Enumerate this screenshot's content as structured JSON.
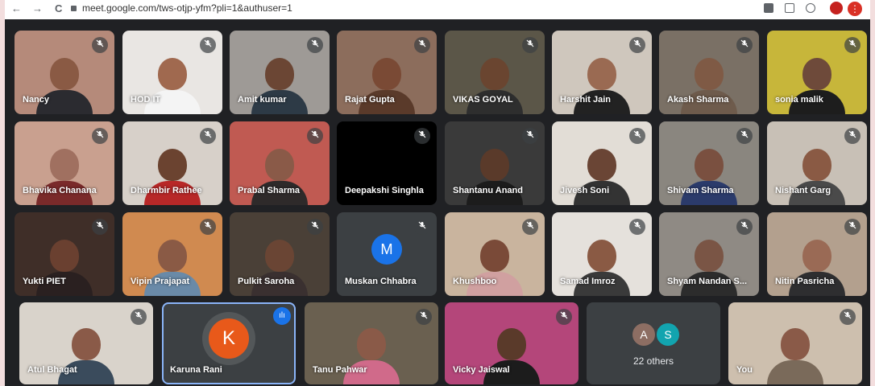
{
  "browser": {
    "url": "meet.google.com/tws-otjp-yfm?pli=1&authuser=1",
    "back": "←",
    "forward": "→",
    "reload": "C",
    "menu": "⋮"
  },
  "mute_glyph": "🎙",
  "participants": [
    {
      "name": "Nancy",
      "skin": "#8a5a44",
      "bg": "#b58a7a",
      "shirt": "#2b2b30"
    },
    {
      "name": "HOD IT",
      "skin": "#a0694f",
      "bg": "#e9e6e3",
      "shirt": "#f4f4f4"
    },
    {
      "name": "Amit kumar",
      "skin": "#6b4634",
      "bg": "#9e9a96",
      "shirt": "#2d3a46"
    },
    {
      "name": "Rajat Gupta",
      "skin": "#7a4a35",
      "bg": "#8c6d5c",
      "shirt": "#5a3a2a"
    },
    {
      "name": "VIKAS GOYAL",
      "skin": "#6a4530",
      "bg": "#5b5648",
      "shirt": "#2e2e2e"
    },
    {
      "name": "Harshit Jain",
      "skin": "#9a6a52",
      "bg": "#cfc7bd",
      "shirt": "#222"
    },
    {
      "name": "Akash Sharma",
      "skin": "#7f5a45",
      "bg": "#7a7065",
      "shirt": "#6e5b4c"
    },
    {
      "name": "sonia malik",
      "skin": "#6e4a3a",
      "bg": "#c7b63a",
      "shirt": "#1d1d1d"
    },
    {
      "name": "Bhavika Chanana",
      "skin": "#a07060",
      "bg": "#c9a08f",
      "shirt": "#7a2a2a"
    },
    {
      "name": "Dharmbir Rathee",
      "skin": "#6b4330",
      "bg": "#d7d0c9",
      "shirt": "#b82828"
    },
    {
      "name": "Prabal Sharma",
      "skin": "#8a5a48",
      "bg": "#c05a52",
      "shirt": "#2e2a2a"
    },
    {
      "name": "Deepakshi Singhla",
      "skin": "#000000",
      "bg": "#000000",
      "shirt": "#000000"
    },
    {
      "name": "Shantanu Anand",
      "skin": "#5a3a2a",
      "bg": "#3a3a3a",
      "shirt": "#1c1c1c"
    },
    {
      "name": "Jivesh Soni",
      "skin": "#6a4535",
      "bg": "#e2ddd6",
      "shirt": "#333"
    },
    {
      "name": "Shivam Sharma",
      "skin": "#7a5040",
      "bg": "#8a867f",
      "shirt": "#2b3b6b"
    },
    {
      "name": "Nishant Garg",
      "skin": "#8a5a44",
      "bg": "#c8c0b6",
      "shirt": "#4a4a4a"
    },
    {
      "name": "Yukti PIET",
      "skin": "#6a4030",
      "bg": "#3f2e28",
      "shirt": "#2a2020"
    },
    {
      "name": "Vipin Prajapat",
      "skin": "#8a5a45",
      "bg": "#d08a50",
      "shirt": "#6a8aa8"
    },
    {
      "name": "Pulkit Saroha",
      "skin": "#6a4534",
      "bg": "#4a4037",
      "shirt": "#3a3030"
    },
    {
      "name": "Muskan Chhabra",
      "avatar": "M",
      "avatar_color": "#1a73e8"
    },
    {
      "name": "Khushboo",
      "skin": "#7a4a38",
      "bg": "#c9b49e",
      "shirt": "#d0a0a0"
    },
    {
      "name": "Samad Imroz",
      "skin": "#8a5a44",
      "bg": "#e5e1dc",
      "shirt": "#3a3a3a"
    },
    {
      "name": "Shyam Nandan S...",
      "skin": "#7a5545",
      "bg": "#8f8a84",
      "shirt": "#2c2c2c"
    },
    {
      "name": "Nitin Pasricha",
      "skin": "#9a6a55",
      "bg": "#b3a08e",
      "shirt": "#2e2e30"
    },
    {
      "name": "Atul Bhagat",
      "skin": "#8a5a48",
      "bg": "#d9d3cb",
      "shirt": "#3a4b5c"
    },
    {
      "name": "Karuna Rani",
      "avatar": "K",
      "avatar_color": "#e8591a",
      "speaking": true
    },
    {
      "name": "Tanu Pahwar",
      "skin": "#8a5a48",
      "bg": "#6a6050",
      "shirt": "#d06a8a"
    },
    {
      "name": "Vicky Jaiswal",
      "skin": "#5a3a2a",
      "bg": "#b4467a",
      "shirt": "#1c1c1c"
    },
    {
      "name": "You",
      "skin": "#8a5a48",
      "bg": "#cdbfae",
      "shirt": "#7a6a5a"
    }
  ],
  "others": {
    "label": "22 others",
    "avatars": [
      {
        "letter": "A",
        "color": "#8d6e63"
      },
      {
        "letter": "S",
        "color": "#12a4af"
      }
    ]
  },
  "speaking_glyph": "ılı"
}
